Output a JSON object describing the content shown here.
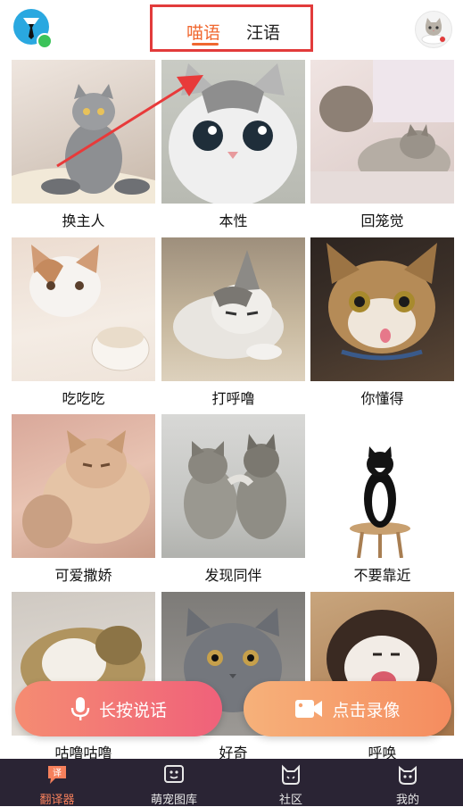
{
  "header": {
    "tabs": [
      {
        "label": "喵语",
        "active": true
      },
      {
        "label": "汪语",
        "active": false
      }
    ],
    "accent_color": "#f0672f",
    "highlight_box_color": "#e23b3b"
  },
  "grid": {
    "items": [
      {
        "label": "换主人"
      },
      {
        "label": "本性"
      },
      {
        "label": "回笼觉"
      },
      {
        "label": "吃吃吃"
      },
      {
        "label": "打呼噜"
      },
      {
        "label": "你懂得"
      },
      {
        "label": "可爱撒娇"
      },
      {
        "label": "发现同伴"
      },
      {
        "label": "不要靠近"
      },
      {
        "label": "咕噜咕噜"
      },
      {
        "label": "好奇"
      },
      {
        "label": "呼唤"
      }
    ]
  },
  "actions": {
    "voice_label": "长按说话",
    "video_label": "点击录像"
  },
  "bottom_nav": {
    "items": [
      {
        "label": "翻译器",
        "icon": "translate-icon",
        "badge": "译",
        "active": true
      },
      {
        "label": "萌宠图库",
        "icon": "gallery-icon",
        "active": false
      },
      {
        "label": "社区",
        "icon": "community-cat-icon",
        "active": false
      },
      {
        "label": "我的",
        "icon": "profile-cat-icon",
        "active": false
      }
    ],
    "background_color": "#2a2434",
    "active_color": "#f6805c"
  }
}
